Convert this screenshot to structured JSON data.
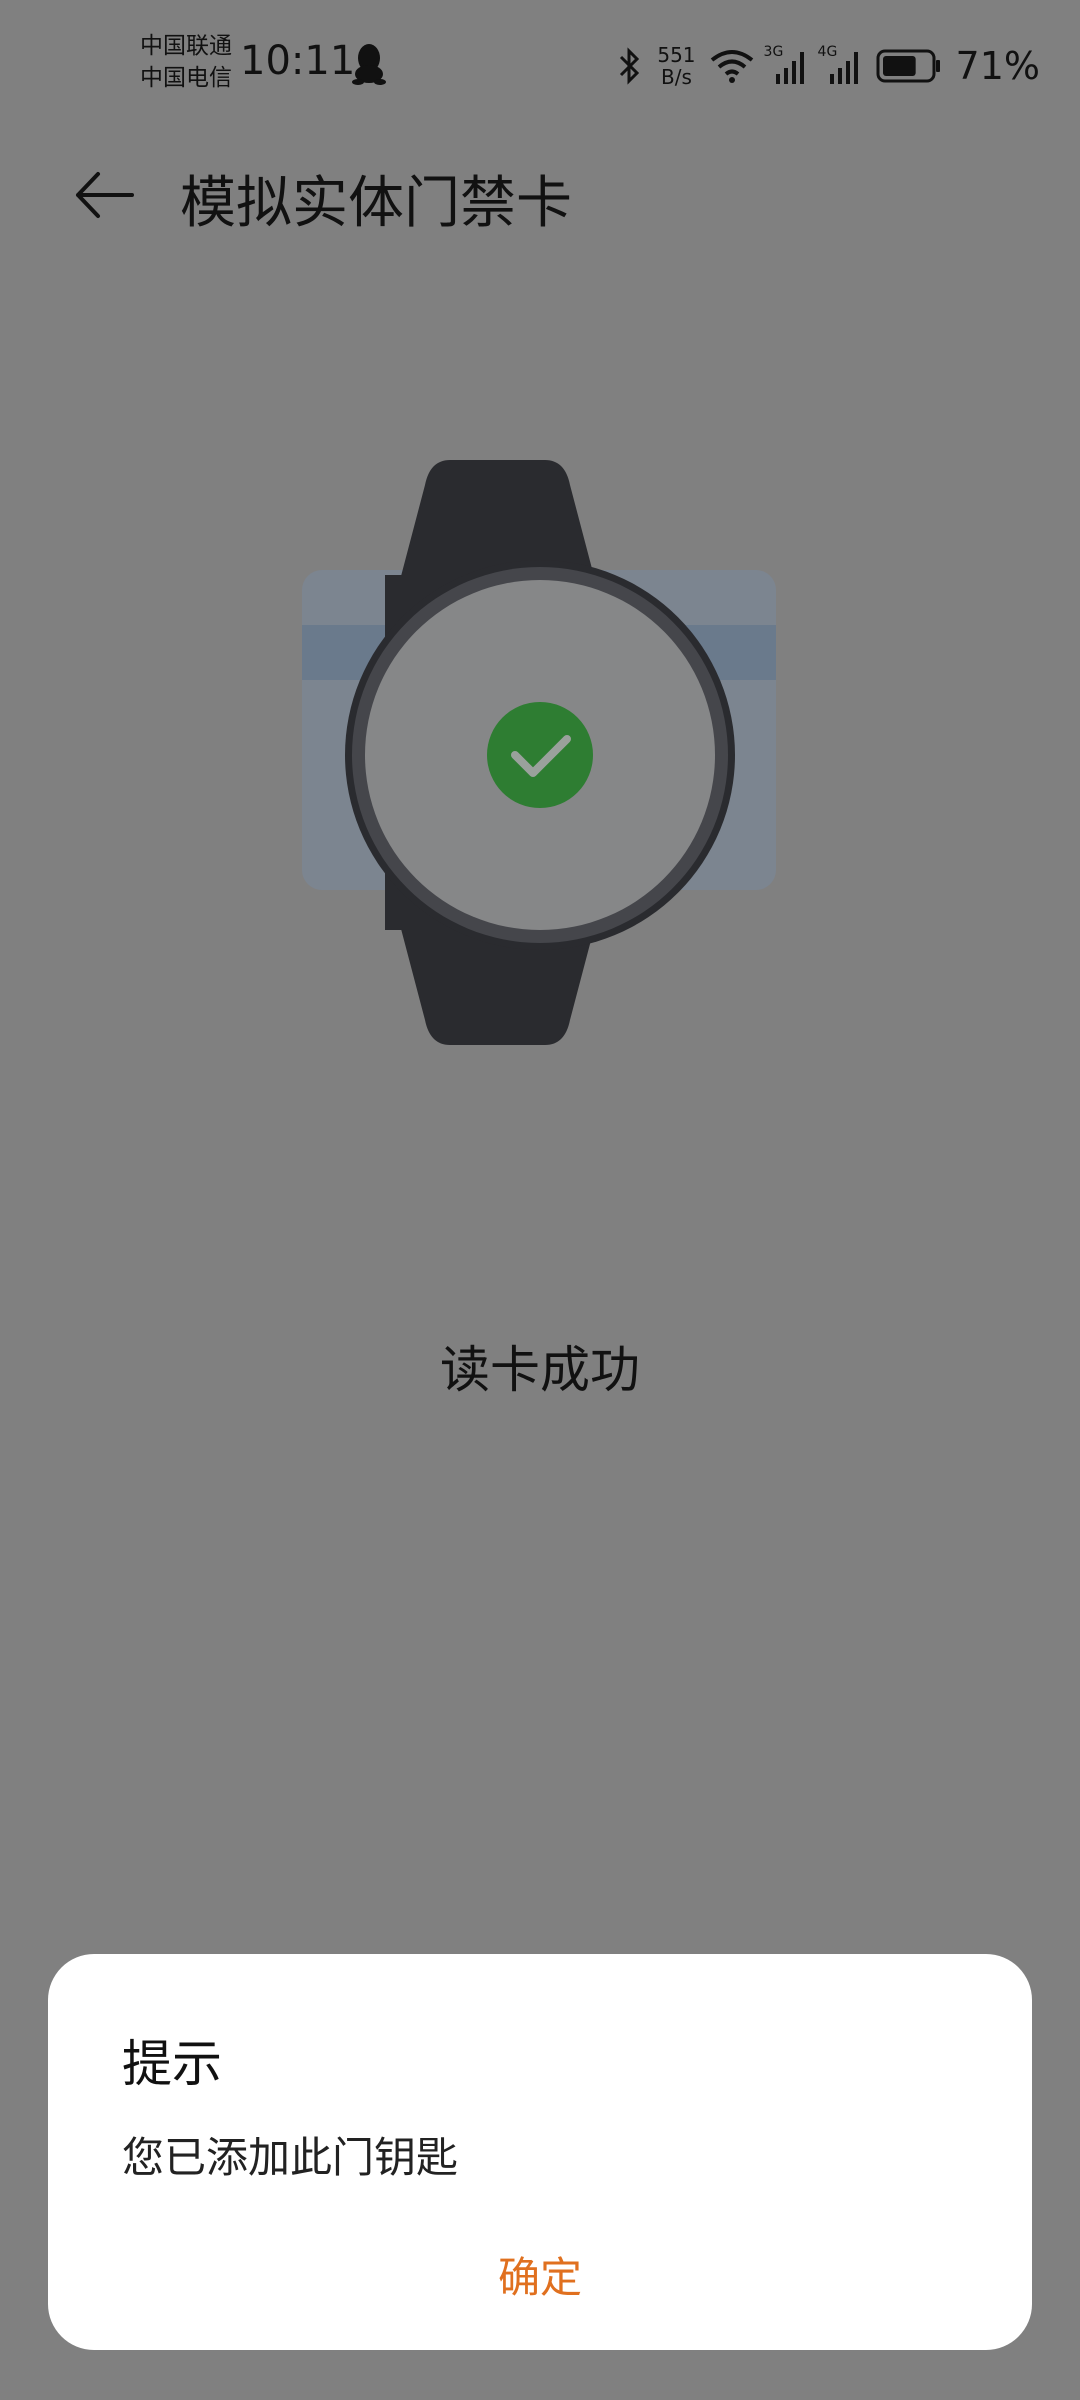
{
  "status_bar": {
    "carrier_1": "中国联通",
    "carrier_2": "中国电信",
    "time": "10:11",
    "net_speed_value": "551",
    "net_speed_unit": "B/s",
    "network_1": "3G",
    "network_2": "4G",
    "battery_percent": "71%",
    "battery_level": 0.71
  },
  "header": {
    "title": "模拟实体门禁卡"
  },
  "main": {
    "status_text": "读卡成功"
  },
  "dialog": {
    "title": "提示",
    "message": "您已添加此门钥匙",
    "confirm_label": "确定"
  },
  "colors": {
    "overlay_bg": "#808080",
    "accent": "#e0701f",
    "success_green": "#2e7d32"
  }
}
